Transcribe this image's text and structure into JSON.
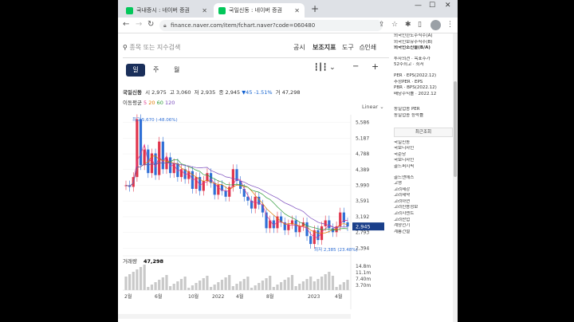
{
  "tabs": [
    {
      "label": "국내증시 : 네이버 증권"
    },
    {
      "label": "국일신동 : 네이버 증권"
    }
  ],
  "address": "finance.naver.com/item/fchart.naver?code=060480",
  "search_placeholder": "종목 또는 지수검색",
  "menu": {
    "gongsi": "공시",
    "indicator": "보조지표",
    "tools": "도구",
    "print": "인쇄"
  },
  "periods": [
    "일",
    "주",
    "월"
  ],
  "stats": {
    "name": "국일신동",
    "open": "시 2,975",
    "high": "고 3,060",
    "low": "저 2,935",
    "close": "종 2,945",
    "change": "▼45 -1.51%",
    "volume": "거 47,298"
  },
  "ma": {
    "label": "이동평균",
    "v5": "5",
    "v20": "20",
    "v60": "60",
    "v120": "120"
  },
  "scale": "Linear",
  "chart_data": {
    "type": "candlestick",
    "price_ticks": [
      "5,586",
      "5,187",
      "4,788",
      "4,389",
      "3,990",
      "3,591",
      "3,192",
      "2,793",
      "2,394"
    ],
    "current_price": "2,945",
    "max_label": "최고 5,670 (-48.06%)",
    "min_label": "최저 2,385 (23.48%)",
    "x_ticks": [
      "2월",
      "6월",
      "10월",
      "2022",
      "4월",
      "8월",
      "2023",
      "4월"
    ],
    "volume_label": "거래량",
    "volume_value": "47,298",
    "volume_ticks": [
      "14.8m",
      "11.1m",
      "7.40m",
      "3.70m"
    ],
    "price_series": [
      3990,
      3950,
      4200,
      5670,
      4500,
      4900,
      4300,
      4800,
      4250,
      5100,
      4400,
      4700,
      4300,
      4550,
      4200,
      4400,
      4150,
      4350,
      3900,
      4200,
      3850,
      4100,
      4300,
      4050,
      3750,
      4000,
      3850,
      3700,
      3950,
      4400,
      4100,
      3900,
      3700,
      3600,
      3400,
      3700,
      3500,
      3300,
      2900,
      3100,
      2900,
      3200,
      3050,
      2850,
      3000,
      3100,
      2800,
      2950,
      3050,
      2700,
      2500,
      2850,
      2600,
      2950,
      3100,
      2900,
      2800,
      2950,
      3300,
      3050,
      2945
    ]
  },
  "right": {
    "top": [
      "외국인한도주식수(A)",
      "외국인보유주식수(B)",
      "외국인소진율(B/A)",
      "투자의견 · 목표주가",
      "52주최고 · 최저",
      "PER · EPS(2022.12)",
      "추정PER · EPS",
      "PBR · BPS(2022.12)",
      "배당수익률 · 2022.12"
    ],
    "industry": [
      "동일업종 PER",
      "동일업종 등락률"
    ],
    "recent_title": "최근조회",
    "recent": [
      "국일신동",
      "국보디자인",
      "국순당",
      "국보디자인",
      "골드퍼시픽",
      "골드앤에스",
      "고영",
      "고려제강",
      "고려제약",
      "고려아연",
      "고려신용정보",
      "고려시멘트",
      "고려산업",
      "계양전기",
      "계룡건설"
    ]
  }
}
